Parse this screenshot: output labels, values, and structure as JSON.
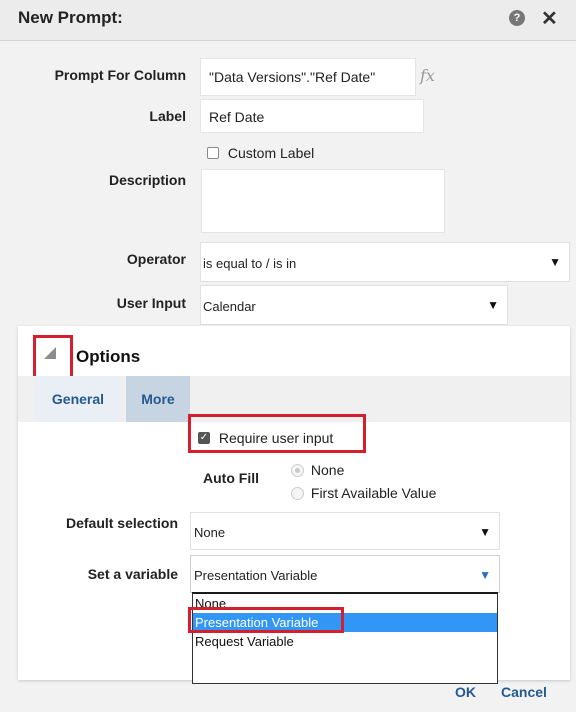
{
  "dialog": {
    "title": "New Prompt:",
    "help_icon": "question-circle-icon",
    "close_icon": "close-icon"
  },
  "form": {
    "prompt_for_column_label": "Prompt For Column",
    "prompt_for_column_value": "\"Data Versions\".\"Ref Date\"",
    "fx_label": "fx",
    "label_label": "Label",
    "label_value": "Ref Date",
    "custom_label_text": "Custom Label",
    "custom_label_checked": false,
    "description_label": "Description",
    "description_value": "",
    "operator_label": "Operator",
    "operator_value": "is equal to / is in",
    "user_input_label": "User Input",
    "user_input_value": "Calendar"
  },
  "options": {
    "title": "Options",
    "tabs": [
      {
        "label": "General",
        "active": false
      },
      {
        "label": "More",
        "active": true
      }
    ],
    "require_user_input_text": "Require user input",
    "require_user_input_checked": true,
    "auto_fill_label": "Auto Fill",
    "auto_fill_options": [
      {
        "label": "None",
        "selected": true
      },
      {
        "label": "First Available Value",
        "selected": false
      }
    ],
    "default_selection_label": "Default selection",
    "default_selection_value": "None",
    "set_variable_label": "Set a variable",
    "set_variable_value": "Presentation Variable",
    "set_variable_dropdown": [
      {
        "label": "None",
        "selected": false
      },
      {
        "label": "Presentation Variable",
        "selected": true
      },
      {
        "label": "Request Variable",
        "selected": false
      }
    ]
  },
  "footer": {
    "ok_label": "OK",
    "cancel_label": "Cancel"
  },
  "colors": {
    "accent": "#23598f",
    "highlight_box": "#d41f2e",
    "selected_option": "#3296f6"
  }
}
